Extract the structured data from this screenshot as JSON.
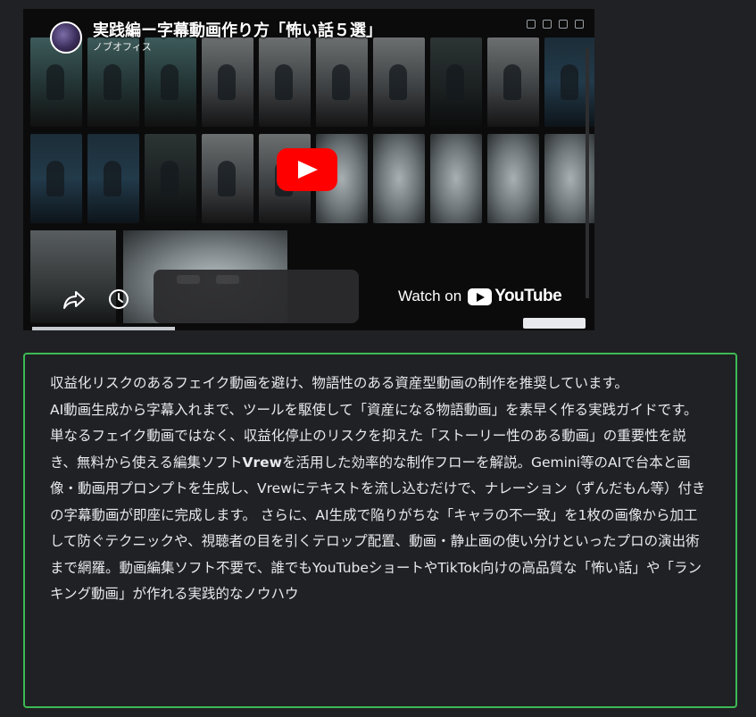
{
  "video": {
    "title": "実践編ー字幕動画作り方「怖い話５選」",
    "channel": "ノブオフィス",
    "watch_on_label": "Watch on",
    "youtube_wordmark": "YouTube",
    "play_icon": "play-icon",
    "share_icon": "share-icon",
    "watch_later_icon": "clock-icon",
    "accent_color": "#ff0000"
  },
  "description": {
    "border_color": "#3cba54",
    "line1": "収益化リスクのあるフェイク動画を避け、物語性のある資産型動画の制作を推奨しています。",
    "p2_part1": "AI動画生成から字幕入れまで、ツールを駆使して「資産になる物語動画」を素早く作る実践ガイドです。単なるフェイク動画ではなく、収益化停止のリスクを抑えた「ストーリー性のある動画」の重要性を説き、無料から使える編集ソフト",
    "p2_strong": "Vrew",
    "p2_part2": "を活用した効率的な制作フローを解説。Gemini等のAIで台本と画像・動画用プロンプトを生成し、Vrewにテキストを流し込むだけで、ナレーション（ずんだもん等）付きの字幕動画が即座に完成します。 さらに、AI生成で陥りがちな「キャラの不一致」を1枚の画像から加工して防ぐテクニックや、視聴者の目を引くテロップ配置、動画・静止画の使い分けといったプロの演出術まで網羅。動画編集ソフト不要で、誰でもYouTubeショートやTikTok向けの高品質な「怖い話」や「ランキング動画」が作れる実践的なノウハウ"
  }
}
